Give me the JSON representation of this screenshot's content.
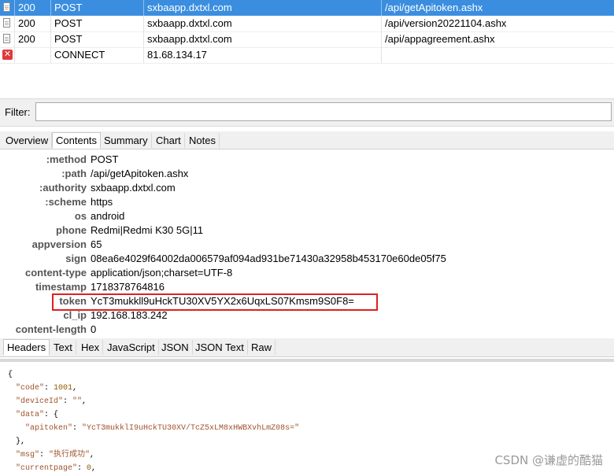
{
  "sessions": [
    {
      "result": "200",
      "protocol": "POST",
      "host": "sxbaapp.dxtxl.com",
      "url": "/api/getApitoken.ashx",
      "icon": "document-icon",
      "selected": true
    },
    {
      "result": "200",
      "protocol": "POST",
      "host": "sxbaapp.dxtxl.com",
      "url": "/api/version20221104.ashx",
      "icon": "document-icon",
      "selected": false
    },
    {
      "result": "200",
      "protocol": "POST",
      "host": "sxbaapp.dxtxl.com",
      "url": "/api/appagreement.ashx",
      "icon": "document-icon",
      "selected": false
    },
    {
      "result": "",
      "protocol": "CONNECT",
      "host": "81.68.134.17",
      "url": "",
      "icon": "error-icon",
      "selected": false
    }
  ],
  "filter": {
    "label": "Filter:",
    "value": ""
  },
  "request_tabs": [
    "Overview",
    "Contents",
    "Summary",
    "Chart",
    "Notes"
  ],
  "request_tabs_active": "Contents",
  "headers": [
    {
      "name": ":method",
      "value": "POST"
    },
    {
      "name": ":path",
      "value": "/api/getApitoken.ashx"
    },
    {
      "name": ":authority",
      "value": "sxbaapp.dxtxl.com"
    },
    {
      "name": ":scheme",
      "value": "https"
    },
    {
      "name": "os",
      "value": "android"
    },
    {
      "name": "phone",
      "value": "Redmi|Redmi K30 5G|11"
    },
    {
      "name": "appversion",
      "value": "65"
    },
    {
      "name": "sign",
      "value": "08ea6e4029f64002da006579af094ad931be71430a32958b453170e60de05f75"
    },
    {
      "name": "content-type",
      "value": "application/json;charset=UTF-8"
    },
    {
      "name": "timestamp",
      "value": "1718378764816"
    },
    {
      "name": "token",
      "value": "YcT3mukkll9uHckTU30XV5YX2x6UqxLS07Kmsm9S0F8="
    },
    {
      "name": "cl_ip",
      "value": "192.168.183.242"
    },
    {
      "name": "content-length",
      "value": "0"
    }
  ],
  "response_tabs": [
    "Headers",
    "Text",
    "Hex",
    "JavaScript",
    "JSON",
    "JSON Text",
    "Raw"
  ],
  "response_tabs_active": "Headers",
  "body": {
    "open_brace": "{",
    "code_key": "\"code\"",
    "code_val": "1001",
    "deviceid_key": "\"deviceId\"",
    "deviceid_val": "\"\"",
    "data_key": "\"data\"",
    "data_open": "{",
    "apitoken_key": "\"apitoken\"",
    "apitoken_val": "\"YcT3mukklI9uHckTU30XV/TcZ5xLM8xHWBXvhLmZ08s=\"",
    "data_close": "},",
    "msg_key": "\"msg\"",
    "msg_val": "\"执行成功\"",
    "currentpage_key": "\"currentpage\"",
    "currentpage_val": "0"
  },
  "watermark": "CSDN @谦虚的酷猫",
  "colors": {
    "selected_row": "#3b8edf",
    "highlight": "#e02020",
    "error": "#e0393e"
  }
}
